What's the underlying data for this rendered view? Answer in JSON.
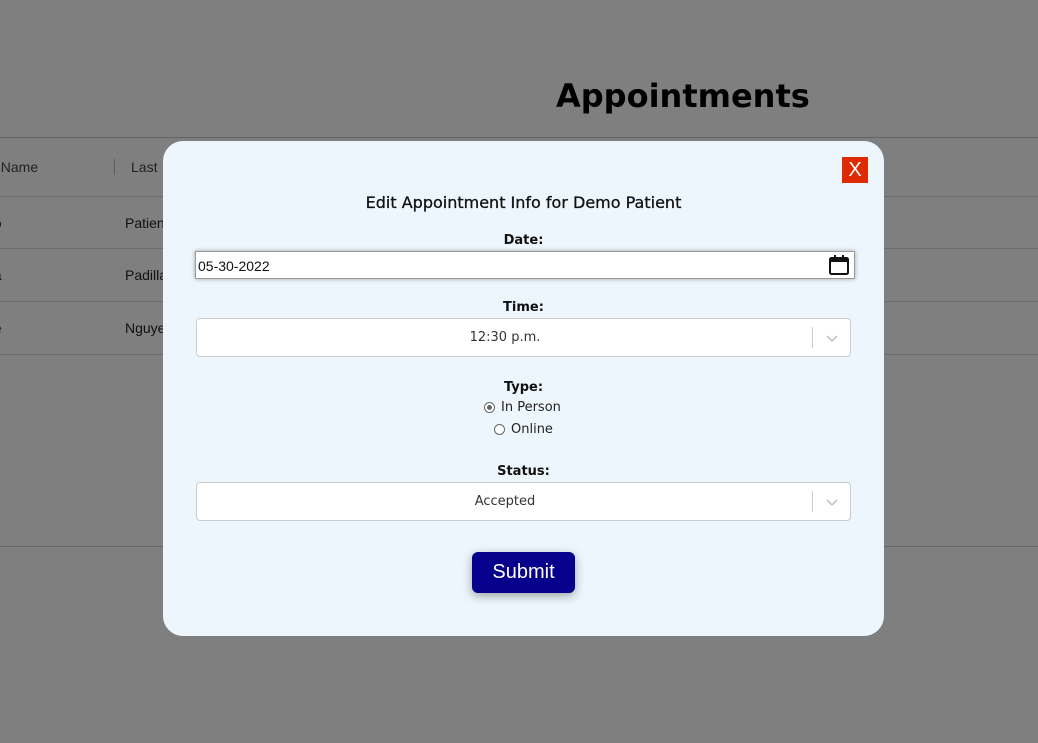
{
  "page": {
    "title": "Appointments"
  },
  "table": {
    "headers": [
      "st Name",
      "Last"
    ],
    "rows": [
      [
        "no",
        "Patien"
      ],
      [
        "na",
        "Padilla"
      ],
      [
        "ge",
        "Nguye"
      ]
    ]
  },
  "modal": {
    "close_label": "X",
    "title": "Edit Appointment Info for Demo Patient",
    "date": {
      "label": "Date:",
      "value": "05-30-2022",
      "icon": "calendar-icon"
    },
    "time": {
      "label": "Time:",
      "value": "12:30 p.m."
    },
    "type": {
      "label": "Type:",
      "options": [
        {
          "label": "In Person",
          "checked": true
        },
        {
          "label": "Online",
          "checked": false
        }
      ]
    },
    "status": {
      "label": "Status:",
      "value": "Accepted"
    },
    "submit_label": "Submit"
  },
  "colors": {
    "overlay": "#000000",
    "modal_background": "#eef6fd",
    "close_button": "#dd2a00",
    "submit_button": "#06008c"
  }
}
